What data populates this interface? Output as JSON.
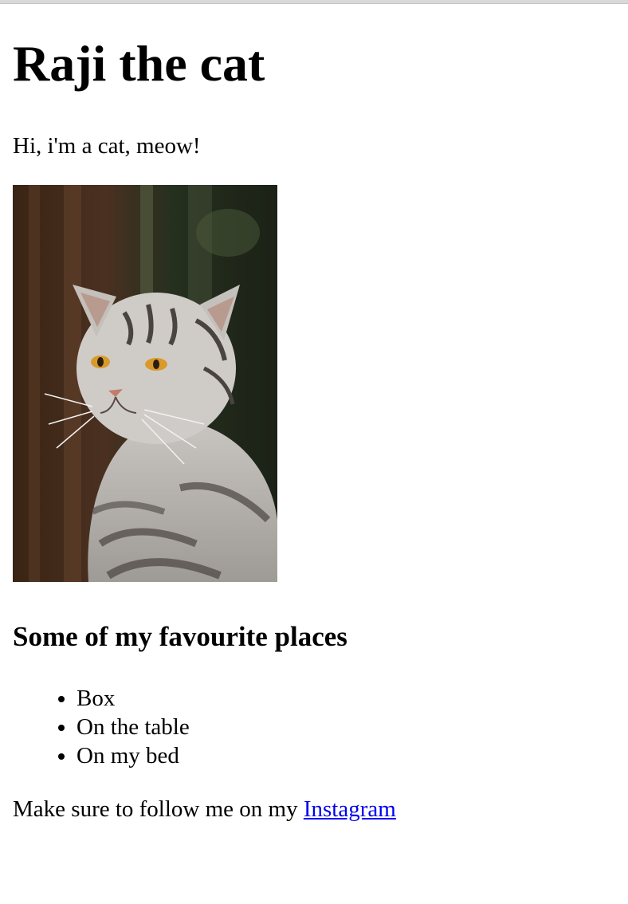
{
  "page": {
    "title": "Raji the cat",
    "intro": "Hi, i'm a cat, meow!",
    "places_heading": "Some of my favourite places",
    "places": [
      "Box",
      "On the table",
      "On my bed"
    ],
    "follow_text": "Make sure to follow me on my ",
    "follow_link_label": "Instagram"
  },
  "colors": {
    "link": "#0000ee",
    "text": "#000000",
    "background": "#ffffff"
  }
}
